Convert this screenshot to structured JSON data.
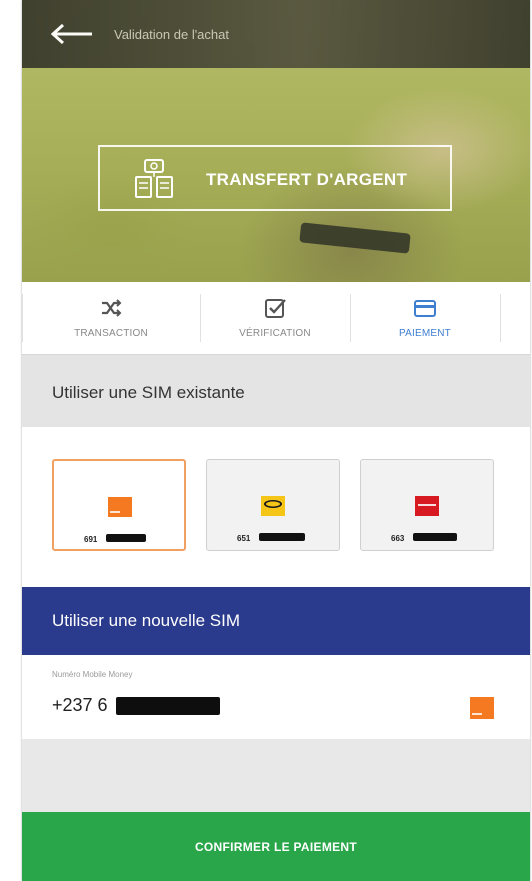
{
  "header": {
    "title": "Validation de l'achat",
    "back_icon": "arrow-left-icon"
  },
  "hero": {
    "label": "TRANSFERT D'ARGENT",
    "icon": "money-transfer-icon"
  },
  "steps": [
    {
      "label": "TRANSACTION",
      "icon": "shuffle-icon",
      "active": false
    },
    {
      "label": "VÉRIFICATION",
      "icon": "checkbox-icon",
      "active": false
    },
    {
      "label": "PAIEMENT",
      "icon": "credit-card-icon",
      "active": true
    }
  ],
  "existing_sim": {
    "heading": "Utiliser une SIM existante",
    "cards": [
      {
        "prefix": "691",
        "operator": "Orange",
        "color": "#f47920",
        "selected": true
      },
      {
        "prefix": "651",
        "operator": "MTN",
        "color": "#f5c518",
        "selected": false
      },
      {
        "prefix": "663",
        "operator": "Nexttel",
        "color": "#d71a21",
        "selected": false
      }
    ]
  },
  "new_sim": {
    "heading": "Utiliser une nouvelle SIM",
    "field_label": "Numéro Mobile Money",
    "field_value": "+237 6"
  },
  "confirm": {
    "label": "CONFIRMER LE PAIEMENT"
  },
  "colors": {
    "new_sim_header": "#2a3a8c",
    "confirm_button": "#2aa64a",
    "active_step": "#3f7fd0",
    "selected_border": "#f0a060"
  }
}
